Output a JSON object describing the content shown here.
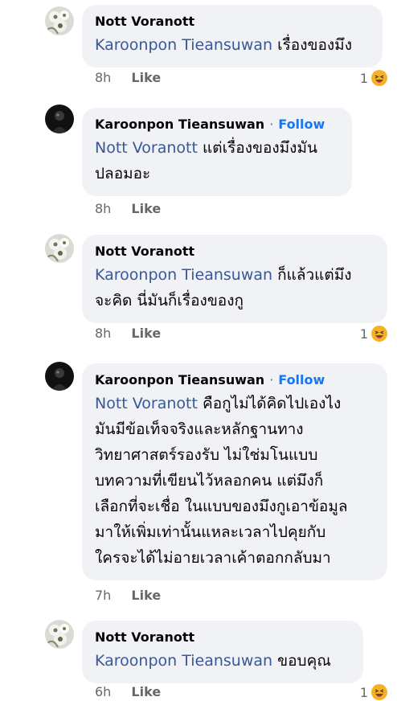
{
  "comments": [
    {
      "author": "Nott Voranott",
      "follow": "",
      "mention": "Karoonpon Tieansuwan",
      "lines": [
        "เรื่องของมึง"
      ],
      "time": "8h",
      "like": "Like",
      "reaction_count": "1"
    },
    {
      "author": "Karoonpon Tieansuwan",
      "follow": "Follow",
      "mention": "Nott Voranott",
      "lines": [
        "แต่เรื่องของมึงมัน",
        "ปลอมอะ"
      ],
      "time": "8h",
      "like": "Like",
      "reaction_count": ""
    },
    {
      "author": "Nott Voranott",
      "follow": "",
      "mention": "Karoonpon Tieansuwan",
      "lines": [
        "ก็แล้วแต่มึง",
        "จะคิด นี่มันก็เรื่องของกู"
      ],
      "time": "8h",
      "like": "Like",
      "reaction_count": "1"
    },
    {
      "author": "Karoonpon Tieansuwan",
      "follow": "Follow",
      "mention": "Nott Voranott",
      "lines": [
        "คือกูไม่ได้คิดไปเองไง",
        "มันมีข้อเท็จจริงและหลักฐานทาง",
        "วิทยาศาสตร์รองรับ ไม่ใช่มโนแบบ",
        "บทความที่เขียนไว้หลอกคน แต่มึงก็",
        "เลือกที่จะเชื่อ ในแบบของมึงกูเอาข้อมูล",
        "มาให้เพิ่มเท่านั้นแหละเวลาไปคุยกับ",
        "ใครจะได้ไม่อายเวลาเค้าตอกกลับมา"
      ],
      "time": "7h",
      "like": "Like",
      "reaction_count": ""
    },
    {
      "author": "Nott Voranott",
      "follow": "",
      "mention": "Karoonpon Tieansuwan",
      "lines": [
        "ขอบคุณ"
      ],
      "time": "6h",
      "like": "Like",
      "reaction_count": "1"
    }
  ],
  "icons": {
    "avatar_nott": "flower-avatar-icon",
    "avatar_karoonpon": "dark-avatar-icon",
    "reaction": "haha-emoji-icon"
  },
  "colors": {
    "bubble": "#f0f2f5",
    "mention": "#385898",
    "follow": "#1877f2",
    "meta": "#65676b",
    "haha": "#f7b125"
  }
}
